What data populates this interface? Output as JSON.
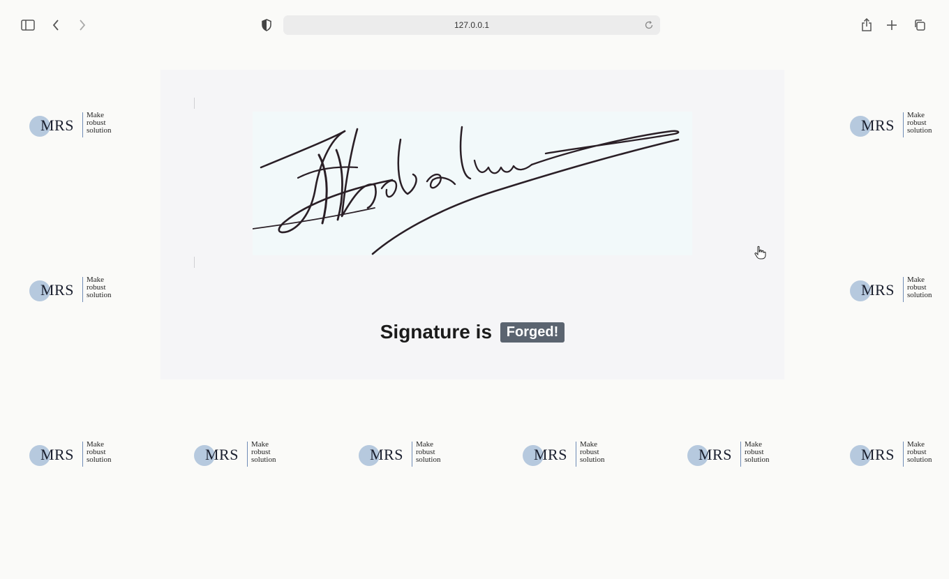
{
  "browser": {
    "address": "127.0.0.1",
    "icons": {
      "sidebar": "sidebar-icon",
      "back": "back-icon",
      "forward": "forward-icon",
      "privacy": "shield-icon",
      "reload": "reload-icon",
      "share": "share-icon",
      "new_tab": "plus-icon",
      "tabs": "tabs-icon"
    }
  },
  "logo": {
    "text": "MRS",
    "tag_line1": "Make",
    "tag_line2": "robust",
    "tag_line3": "solution",
    "circle_color": "#9fb8d6"
  },
  "result": {
    "prefix": "Signature is",
    "status": "Forged!",
    "status_color": "#5b6470"
  }
}
